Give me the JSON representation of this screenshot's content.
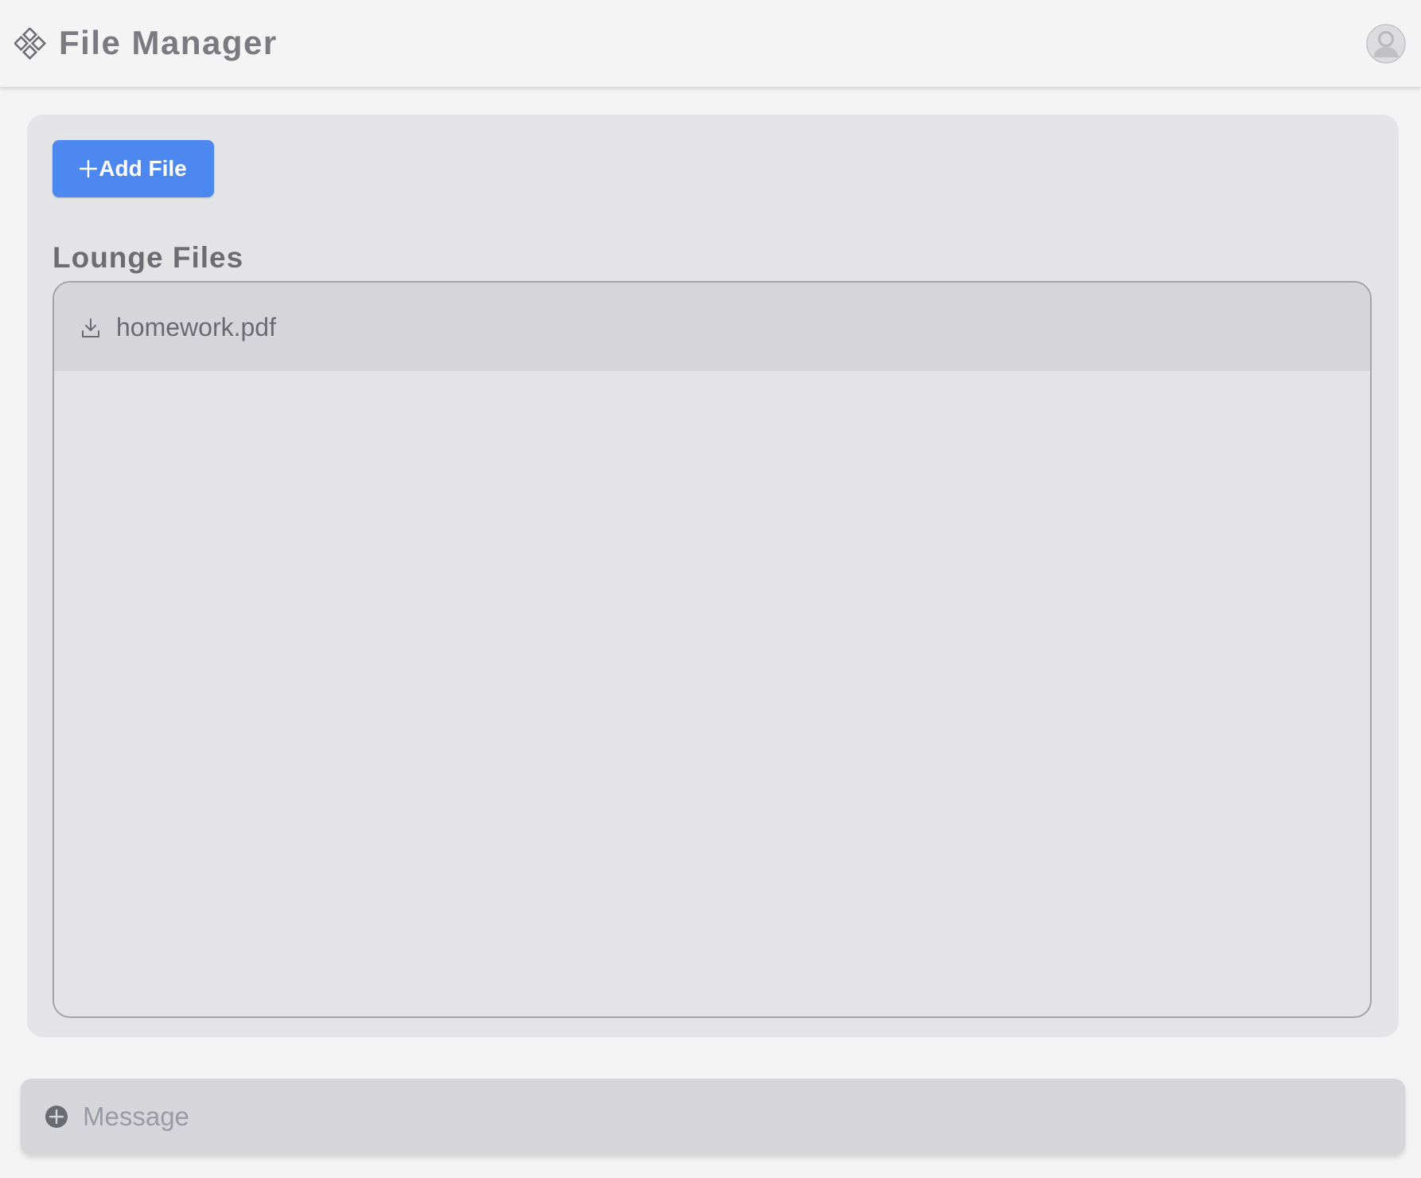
{
  "header": {
    "title": "File Manager",
    "logo_icon": "diamond-grid-icon",
    "avatar_icon": "user-avatar-icon"
  },
  "toolbar": {
    "add_label": "Add File",
    "add_icon": "plus-icon"
  },
  "section": {
    "title": "Lounge Files"
  },
  "files": [
    {
      "name": "homework.pdf",
      "icon": "download-icon"
    }
  ],
  "composer": {
    "placeholder": "Message",
    "icon": "plus-circle-icon"
  },
  "colors": {
    "accent": "#4d88f0",
    "background": "#f3f3f3",
    "panel": "#e4e4e6",
    "row_highlight": "#d5d5da"
  }
}
